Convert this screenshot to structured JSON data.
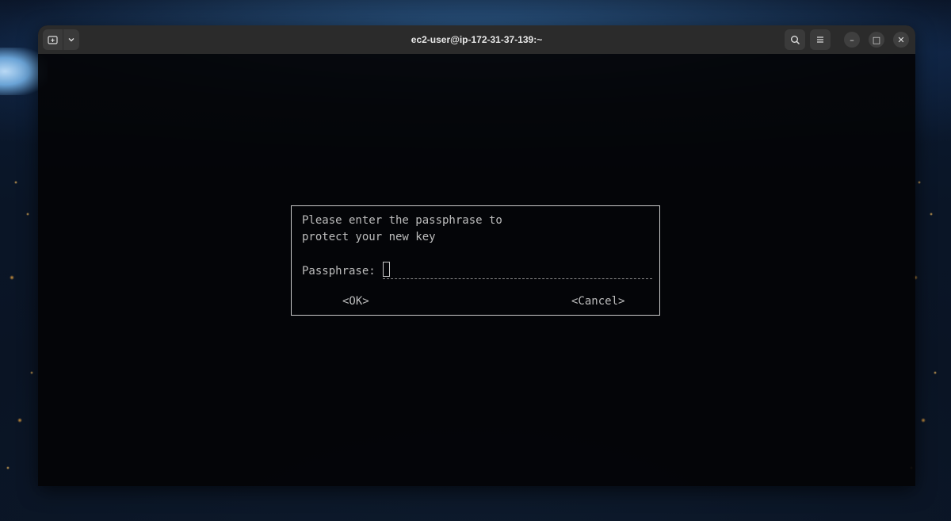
{
  "window": {
    "title": "ec2-user@ip-172-31-37-139:~"
  },
  "titlebar": {
    "new_tab_icon": "new-tab-icon",
    "tab_menu_icon": "chevron-down-icon",
    "search_icon": "search-icon",
    "menu_icon": "hamburger-icon",
    "minimize_glyph": "–",
    "maximize_glyph": "□",
    "close_glyph": "✕"
  },
  "dialog": {
    "message_line1": "Please enter the passphrase to",
    "message_line2": "protect your new key",
    "passphrase_label": "Passphrase:",
    "passphrase_value": "",
    "ok_label": "<OK>",
    "cancel_label": "<Cancel>"
  },
  "colors": {
    "terminal_bg": "#040406",
    "titlebar_bg": "#2b2b2b",
    "text": "#bdbdbd",
    "dialog_border": "#c9c9c9"
  }
}
